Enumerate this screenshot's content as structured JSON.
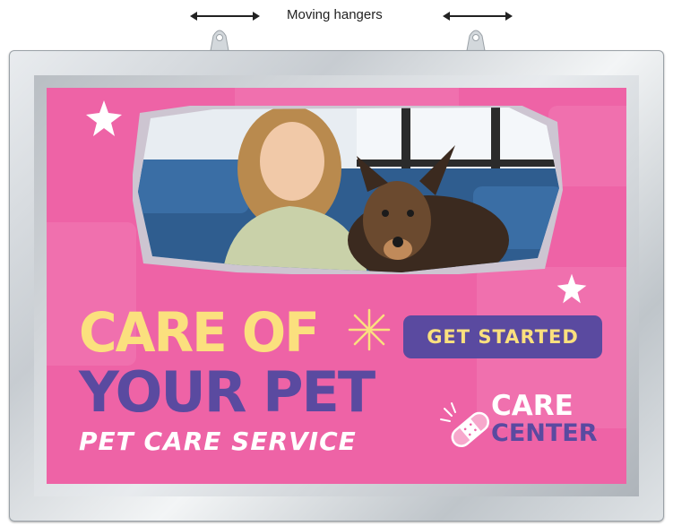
{
  "caption": {
    "text": "Moving hangers"
  },
  "poster": {
    "headline_line1": "CARE OF",
    "headline_line2": "YOUR PET",
    "subheadline": "PET CARE SERVICE",
    "cta_label": "GET STARTED",
    "logo": {
      "line1": "CARE",
      "line2": "CENTER",
      "icon": "bandage-icon"
    },
    "photo": {
      "description_icon": "woman-with-dog-photo"
    }
  },
  "colors": {
    "poster_background": "#ee63a6",
    "headline_yellow": "#fbe07e",
    "brand_purple": "#5a4aa0",
    "frame_silver": "#c7ccd1"
  }
}
